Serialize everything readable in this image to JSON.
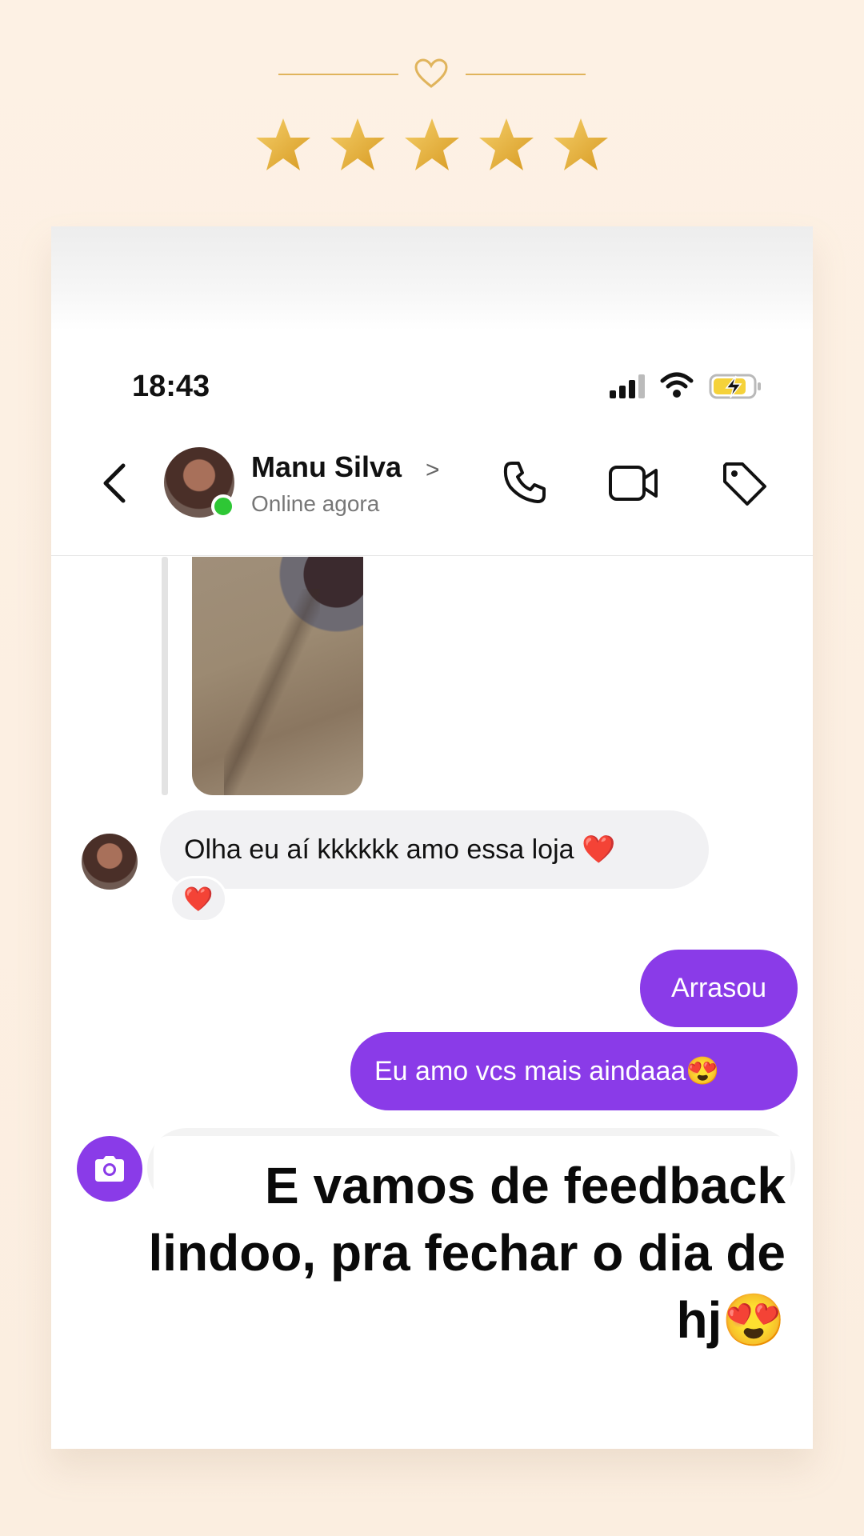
{
  "status_bar": {
    "time": "18:43"
  },
  "chat_header": {
    "contact_name": "Manu Silva",
    "name_chevron": ">",
    "presence": "Online agora"
  },
  "messages": {
    "incoming_text": "Olha eu aí kkkkkk amo essa loja ❤️",
    "reaction": "❤️",
    "outgoing_1": "Arrasou",
    "outgoing_2": "Eu amo vcs mais aindaaa😍"
  },
  "caption": {
    "text": "E vamos de feedback lindoo, pra fechar o dia de hj😍"
  },
  "colors": {
    "accent_purple": "#8a3be8",
    "star_gold": "#e8b43a",
    "online_green": "#2ec735",
    "background": "#fdf1e4"
  },
  "rating": {
    "stars": 5
  }
}
